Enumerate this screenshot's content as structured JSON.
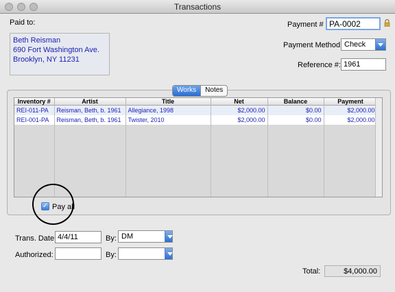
{
  "window": {
    "title": "Transactions"
  },
  "paid_to": {
    "label": "Paid to:",
    "name": "Beth Reisman",
    "street": "690 Fort Washington Ave.",
    "city": "Brooklyn, NY 11231"
  },
  "payment": {
    "number_label": "Payment #",
    "number_value": "PA-0002",
    "method_label": "Payment Method:",
    "method_value": "Check",
    "reference_label": "Reference #:",
    "reference_value": "1961"
  },
  "tabs": [
    {
      "label": "Works",
      "active": true
    },
    {
      "label": "Notes",
      "active": false
    }
  ],
  "table": {
    "columns": [
      "Inventory #",
      "Artist",
      "Title",
      "Net",
      "Balance",
      "Payment"
    ],
    "rows": [
      [
        "REI-011-PA",
        "Reisman, Beth, b. 1961",
        "Allegiance, 1998",
        "$2,000.00",
        "$0.00",
        "$2,000.00"
      ],
      [
        "REI-001-PA",
        "Reisman, Beth, b. 1961",
        "Twister, 2010",
        "$2,000.00",
        "$0.00",
        "$2,000.00"
      ]
    ]
  },
  "pay_all": {
    "label": "Pay all",
    "checked": true
  },
  "trans": {
    "date_label": "Trans. Date:",
    "date_value": "4/4/11",
    "by_label": "By:",
    "by_value": "DM"
  },
  "authorized": {
    "label": "Authorized:",
    "value": "",
    "by_label": "By:",
    "by_value": ""
  },
  "total": {
    "label": "Total:",
    "value": "$4,000.00"
  },
  "colors": {
    "link_blue": "#1b1fb3",
    "accent": "#2b6cd1"
  }
}
